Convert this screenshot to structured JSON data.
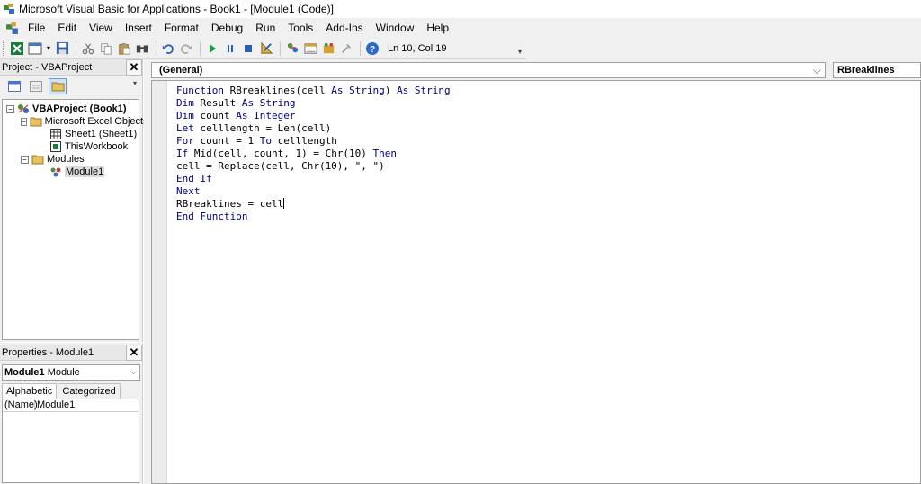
{
  "window": {
    "title": "Microsoft Visual Basic for Applications - Book1 - [Module1 (Code)]"
  },
  "menu": [
    "File",
    "Edit",
    "View",
    "Insert",
    "Format",
    "Debug",
    "Run",
    "Tools",
    "Add-Ins",
    "Window",
    "Help"
  ],
  "toolbar": {
    "cursor_position": "Ln 10, Col 19"
  },
  "project_pane": {
    "title": "Project - VBAProject",
    "tree": [
      {
        "label": "VBAProject (Book1)",
        "bold": true
      },
      {
        "label": "Microsoft Excel Objects"
      },
      {
        "label": "Sheet1 (Sheet1)"
      },
      {
        "label": "ThisWorkbook"
      },
      {
        "label": "Modules"
      },
      {
        "label": "Module1",
        "selected": true
      }
    ]
  },
  "properties_pane": {
    "title": "Properties - Module1",
    "object_name": "Module1",
    "object_type": "Module",
    "tabs": [
      "Alphabetic",
      "Categorized"
    ],
    "rows": [
      {
        "name": "(Name)",
        "value": "Module1"
      }
    ]
  },
  "code_window": {
    "object_combo": "(General)",
    "procedure_combo": "RBreaklines",
    "lines": [
      [
        {
          "t": "Function",
          "k": true
        },
        {
          "t": " RBreaklines(cell "
        },
        {
          "t": "As String",
          "k": true
        },
        {
          "t": ") "
        },
        {
          "t": "As String",
          "k": true
        }
      ],
      [
        {
          "t": "Dim",
          "k": true
        },
        {
          "t": " Result "
        },
        {
          "t": "As String",
          "k": true
        }
      ],
      [
        {
          "t": "Dim",
          "k": true
        },
        {
          "t": " count "
        },
        {
          "t": "As Integer",
          "k": true
        }
      ],
      [
        {
          "t": "Let",
          "k": true
        },
        {
          "t": " celllength = Len(cell)"
        }
      ],
      [
        {
          "t": "For",
          "k": true
        },
        {
          "t": " count = 1 "
        },
        {
          "t": "To",
          "k": true
        },
        {
          "t": " celllength"
        }
      ],
      [
        {
          "t": "If",
          "k": true
        },
        {
          "t": " Mid(cell, count, 1) = Chr(10) "
        },
        {
          "t": "Then",
          "k": true
        }
      ],
      [
        {
          "t": "cell = Replace(cell, Chr(10), \", \")"
        }
      ],
      [
        {
          "t": "End If",
          "k": true
        }
      ],
      [
        {
          "t": "Next",
          "k": true
        }
      ],
      [
        {
          "t": "RBreaklines = cell"
        }
      ],
      [
        {
          "t": "End Function",
          "k": true
        }
      ]
    ]
  },
  "colors": {
    "keyword": "#00007f",
    "menu_background": "#f0f0f0"
  }
}
